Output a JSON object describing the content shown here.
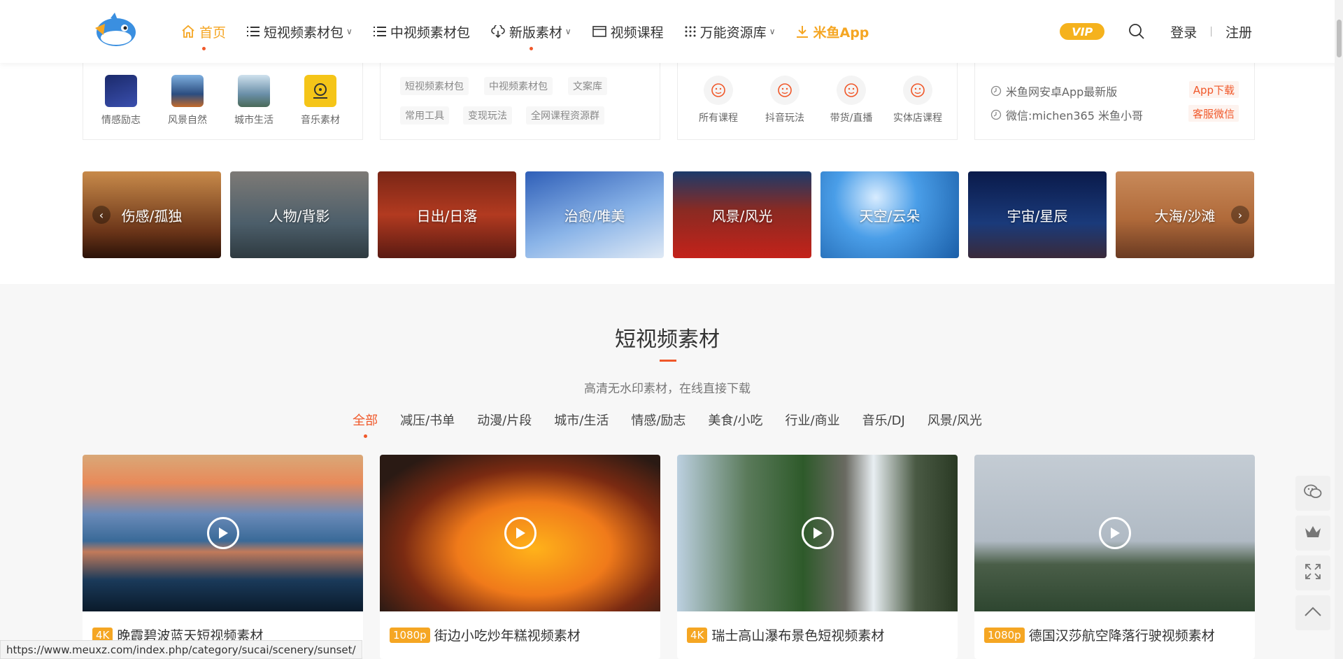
{
  "nav": {
    "items": [
      {
        "label": "首页"
      },
      {
        "label": "短视频素材包"
      },
      {
        "label": "中视频素材包"
      },
      {
        "label": "新版素材"
      },
      {
        "label": "视频课程"
      },
      {
        "label": "万能资源库"
      },
      {
        "label": "米鱼App"
      }
    ]
  },
  "header": {
    "vip": "VIP",
    "login": "登录",
    "sep": "|",
    "register": "注册"
  },
  "quick": {
    "icons": [
      {
        "label": "情感励志"
      },
      {
        "label": "风景自然"
      },
      {
        "label": "城市生活"
      },
      {
        "label": "音乐素材"
      }
    ],
    "tags": [
      "短视频素材包",
      "中视频素材包",
      "文案库",
      "常用工具",
      "变现玩法",
      "全网课程资源群"
    ],
    "courses": [
      {
        "label": "所有课程"
      },
      {
        "label": "抖音玩法"
      },
      {
        "label": "带货/直播"
      },
      {
        "label": "实体店课程"
      }
    ],
    "info": [
      {
        "text": "米鱼网安卓App最新版",
        "button": "App下载"
      },
      {
        "text": "微信:michen365 米鱼小哥",
        "button": "客服微信"
      }
    ]
  },
  "categories": [
    {
      "label": "伤感/孤独"
    },
    {
      "label": "人物/背影"
    },
    {
      "label": "日出/日落"
    },
    {
      "label": "治愈/唯美"
    },
    {
      "label": "风景/风光"
    },
    {
      "label": "天空/云朵"
    },
    {
      "label": "宇宙/星辰"
    },
    {
      "label": "大海/沙滩"
    }
  ],
  "section": {
    "title": "短视频素材",
    "subtitle": "高清无水印素材，在线直接下载",
    "filters": [
      "全部",
      "减压/书单",
      "动漫/片段",
      "城市/生活",
      "情感/励志",
      "美食/小吃",
      "行业/商业",
      "音乐/DJ",
      "风景/风光"
    ]
  },
  "cards": [
    {
      "badge": "4K",
      "title": "晚霞碧波蓝天短视频素材"
    },
    {
      "badge": "1080p",
      "title": "街边小吃炒年糕视频素材"
    },
    {
      "badge": "4K",
      "title": "瑞士高山瀑布景色短视频素材"
    },
    {
      "badge": "1080p",
      "title": "德国汉莎航空降落行驶视频素材"
    }
  ],
  "status_url": "https://www.meuxz.com/index.php/category/sucai/scenery/sunset/",
  "colors": {
    "accent": "#f5a623",
    "brand_red": "#f0582a"
  }
}
